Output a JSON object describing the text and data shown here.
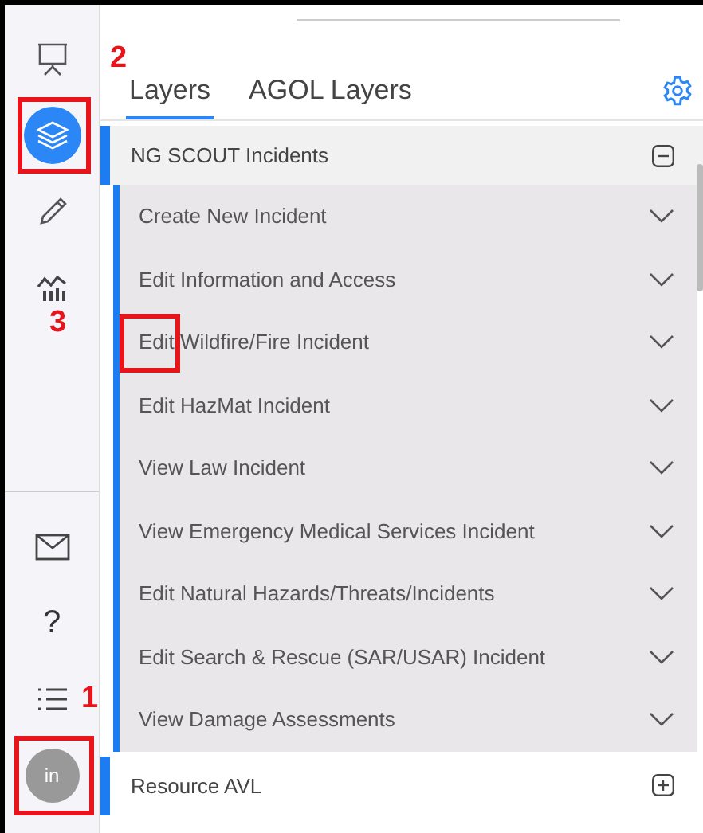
{
  "sidebar": {
    "top_items": [
      {
        "selected": false,
        "highlighted": false
      },
      {
        "selected": true,
        "highlighted": true
      },
      {
        "selected": false,
        "highlighted": false
      },
      {
        "selected": false,
        "highlighted": false,
        "callout": "3"
      }
    ],
    "bottom_items": [
      {
        "kind": "icon",
        "highlighted": false
      },
      {
        "kind": "text",
        "text": "?",
        "highlighted": false
      },
      {
        "kind": "icon",
        "highlighted": false,
        "callout": "1"
      },
      {
        "kind": "avatar",
        "text": "in",
        "highlighted": true
      }
    ]
  },
  "tabs": {
    "callout": "2",
    "items": [
      {
        "label": "Layers",
        "selected": true
      },
      {
        "label": "AGOL Layers",
        "selected": false
      }
    ]
  },
  "groups": [
    {
      "title": "NG SCOUT Incidents",
      "expanded": true,
      "children": [
        {
          "label": "Create New Incident",
          "expanded": false,
          "highlighted": false
        },
        {
          "label": "Edit Information and Access",
          "expanded": false,
          "highlighted": false
        },
        {
          "label": "Edit Wildfire/Fire Incident",
          "expanded": false,
          "highlighted": true
        },
        {
          "label": "Edit HazMat Incident",
          "expanded": false,
          "highlighted": false
        },
        {
          "label": "View Law Incident",
          "expanded": false,
          "highlighted": false
        },
        {
          "label": "View Emergency Medical Services Incident",
          "expanded": false,
          "highlighted": false
        },
        {
          "label": "Edit Natural Hazards/Threats/Incidents",
          "expanded": false,
          "highlighted": false
        },
        {
          "label": "Edit Search & Rescue (SAR/USAR) Incident",
          "expanded": false,
          "highlighted": false
        },
        {
          "label": "View Damage Assessments",
          "expanded": false,
          "highlighted": false
        }
      ]
    },
    {
      "title": "Resource AVL",
      "expanded": false
    }
  ]
}
